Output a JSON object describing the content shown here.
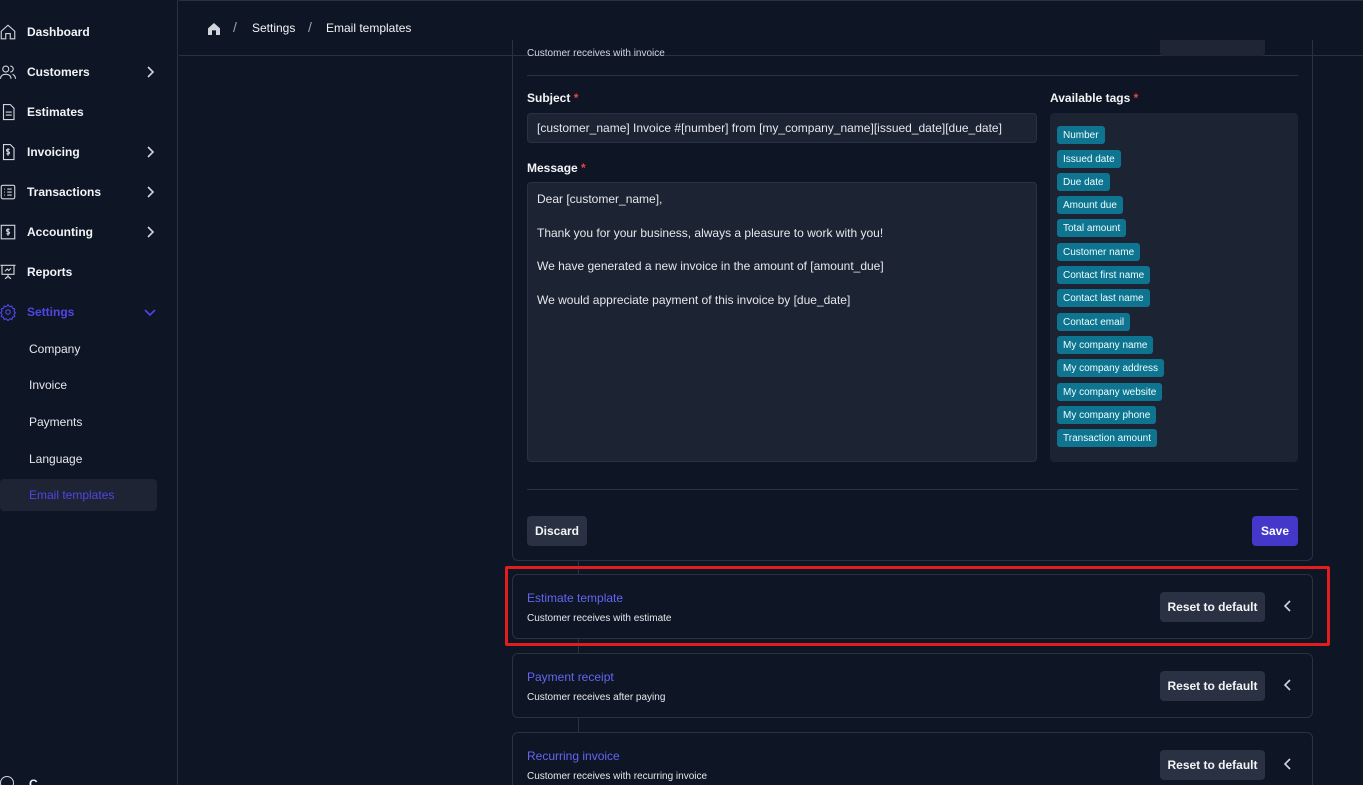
{
  "sidebar": {
    "items": [
      {
        "label": "Dashboard",
        "icon": "home-icon"
      },
      {
        "label": "Customers",
        "icon": "users-icon"
      },
      {
        "label": "Estimates",
        "icon": "document-icon"
      },
      {
        "label": "Invoicing",
        "icon": "invoice-icon"
      },
      {
        "label": "Transactions",
        "icon": "list-icon"
      },
      {
        "label": "Accounting",
        "icon": "accounting-icon"
      },
      {
        "label": "Reports",
        "icon": "presentation-icon"
      },
      {
        "label": "Settings",
        "icon": "gear-icon"
      }
    ],
    "settings_sub": [
      "Company",
      "Invoice",
      "Payments",
      "Language",
      "Email templates"
    ],
    "bottom_partial": "C..."
  },
  "breadcrumb": {
    "items": [
      "Settings",
      "Email templates"
    ]
  },
  "invoice_template": {
    "clipped_desc": "Customer receives with invoice",
    "subject_label": "Subject",
    "subject_value": "[customer_name] Invoice #[number] from [my_company_name][issued_date][due_date]",
    "message_label": "Message",
    "message_lines": [
      "Dear [customer_name],",
      "Thank you for your business, always a pleasure to work with you!",
      "We have generated a new invoice in the amount of [amount_due]",
      "We would appreciate payment of this invoice by [due_date]"
    ],
    "tags_label": "Available tags",
    "required_mark": "*",
    "tags": [
      "Number",
      "Issued date",
      "Due date",
      "Amount due",
      "Total amount",
      "Customer name",
      "Contact first name",
      "Contact last name",
      "Contact email",
      "My company name",
      "My company address",
      "My company website",
      "My company phone",
      "Transaction amount"
    ],
    "discard_label": "Discard",
    "save_label": "Save"
  },
  "templates": [
    {
      "title": "Estimate template",
      "desc": "Customer receives with estimate",
      "reset": "Reset to default"
    },
    {
      "title": "Payment receipt",
      "desc": "Customer receives after paying",
      "reset": "Reset to default"
    },
    {
      "title": "Recurring invoice",
      "desc": "Customer receives with recurring invoice",
      "reset": "Reset to default"
    }
  ],
  "colors": {
    "accent": "#4f46e5",
    "tag": "#0e7490",
    "highlight": "#e11d1d",
    "background": "#0e1525"
  }
}
